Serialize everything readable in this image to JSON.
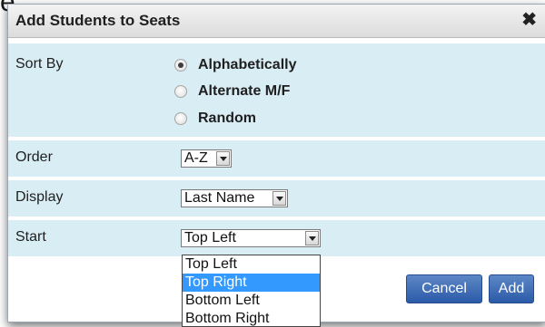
{
  "background": {
    "fragment": "e"
  },
  "dialog": {
    "title": "Add Students to Seats",
    "close_glyph": "✖"
  },
  "sort_by": {
    "label": "Sort By",
    "options": [
      {
        "label": "Alphabetically",
        "checked": true
      },
      {
        "label": "Alternate M/F",
        "checked": false
      },
      {
        "label": "Random",
        "checked": false
      }
    ]
  },
  "order": {
    "label": "Order",
    "value": "A-Z"
  },
  "display": {
    "label": "Display",
    "value": "Last Name"
  },
  "start": {
    "label": "Start",
    "value": "Top Left",
    "options": [
      "Top Left",
      "Top Right",
      "Bottom Left",
      "Bottom Right"
    ],
    "highlighted": "Top Right"
  },
  "buttons": {
    "cancel": "Cancel",
    "add": "Add"
  },
  "colors": {
    "row_bg": "#d9edf4",
    "button": "#3b67b2",
    "highlight": "#3399ff"
  }
}
